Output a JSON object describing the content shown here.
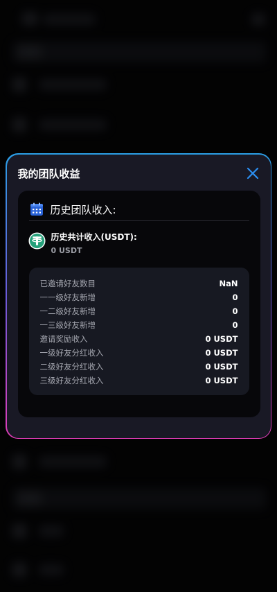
{
  "modal": {
    "title": "我的团队收益"
  },
  "card": {
    "heading": "历史团队收入:",
    "total_label": "历史共计收入(USDT):",
    "total_value": "0 USDT"
  },
  "stats": [
    {
      "label": "已邀请好友数目",
      "value": "NaN"
    },
    {
      "label": "一一级好友新增",
      "value": "0"
    },
    {
      "label": "一二级好友新增",
      "value": "0"
    },
    {
      "label": "一三级好友新增",
      "value": "0"
    },
    {
      "label": "邀请奖励收入",
      "value": "0 USDT"
    },
    {
      "label": "一级好友分红收入",
      "value": "0 USDT"
    },
    {
      "label": "二级好友分红收入",
      "value": "0 USDT"
    },
    {
      "label": "三级好友分红收入",
      "value": "0 USDT"
    }
  ],
  "colors": {
    "accent": "#2b8ef0",
    "usdt": "#26a17b",
    "border_top": "#2b9fe6",
    "border_bottom": "#e23db8"
  }
}
